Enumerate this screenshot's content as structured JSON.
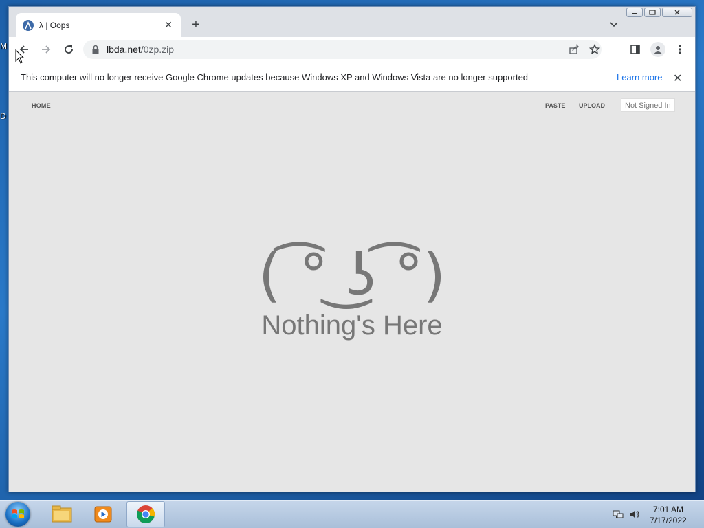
{
  "desktop": {
    "label_1": "M",
    "label_2": "D"
  },
  "browser": {
    "tab": {
      "title": "λ | Oops"
    },
    "address": {
      "host": "lbda.net",
      "path": "/0zp.zip"
    },
    "infobar": {
      "message": "This computer will no longer receive Google Chrome updates because Windows XP and Windows Vista are no longer supported",
      "link": "Learn more"
    }
  },
  "page": {
    "nav": {
      "home": "HOME",
      "paste": "PASTE",
      "upload": "UPLOAD",
      "signin": "Not Signed In"
    },
    "face": "( ͡° ͜ʖ ͡°)",
    "message": "Nothing's Here"
  },
  "taskbar": {
    "time": "7:01 AM",
    "date": "7/17/2022"
  },
  "colors": {
    "content_bg": "#e6e6e6",
    "text_gray": "#777777",
    "link_blue": "#1a73e8"
  }
}
